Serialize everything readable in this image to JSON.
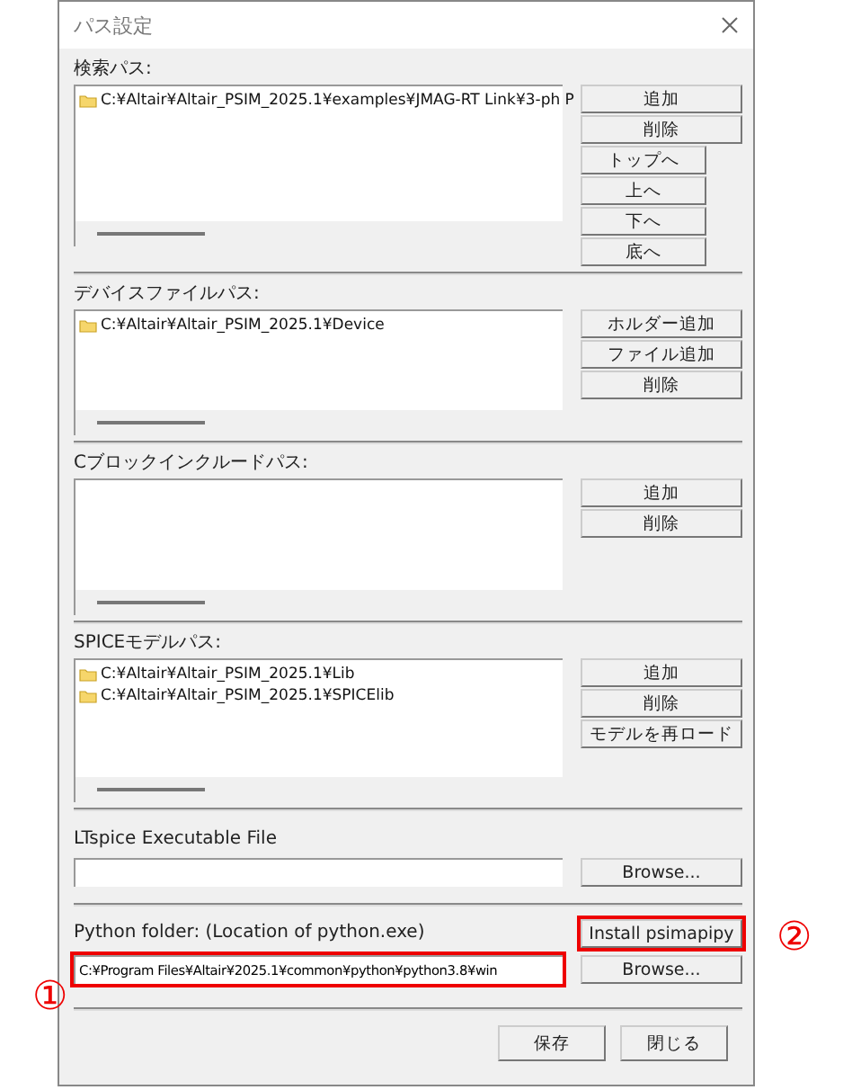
{
  "window": {
    "title": "パス設定"
  },
  "path_sections": [
    {
      "label": "検索パス:",
      "items": [
        "C:¥Altair¥Altair_PSIM_2025.1¥examples¥JMAG-RT Link¥3-ph P"
      ],
      "buttons": [
        {
          "label": "追加",
          "kind": "wide"
        },
        {
          "label": "削除",
          "kind": "wide"
        },
        {
          "label": "トップへ",
          "kind": "narrow"
        },
        {
          "label": "上へ",
          "kind": "narrow"
        },
        {
          "label": "下へ",
          "kind": "narrow"
        },
        {
          "label": "底へ",
          "kind": "narrow"
        }
      ]
    },
    {
      "label": "デバイスファイルパス:",
      "items": [
        "C:¥Altair¥Altair_PSIM_2025.1¥Device"
      ],
      "buttons": [
        {
          "label": "ホルダー追加",
          "kind": "wide"
        },
        {
          "label": "ファイル追加",
          "kind": "wide"
        },
        {
          "label": "削除",
          "kind": "wide"
        }
      ]
    },
    {
      "label": "Cブロックインクルードパス:",
      "buttons": [
        {
          "label": "追加",
          "kind": "wide"
        },
        {
          "label": "削除",
          "kind": "wide"
        }
      ]
    },
    {
      "label": "SPICEモデルパス:",
      "items": [
        "C:¥Altair¥Altair_PSIM_2025.1¥Lib",
        "C:¥Altair¥Altair_PSIM_2025.1¥SPICElib"
      ],
      "buttons": [
        {
          "label": "追加",
          "kind": "wide"
        },
        {
          "label": "削除",
          "kind": "wide"
        },
        {
          "label": "モデルを再ロード",
          "kind": "wide"
        }
      ]
    }
  ],
  "ltspice": {
    "label": "LTspice Executable File",
    "browse": "Browse..."
  },
  "python": {
    "label": "Python folder: (Location of python.exe)",
    "value": "C:¥Program Files¥Altair¥2025.1¥common¥python¥python3.8¥win",
    "value_highlighted": true,
    "install": "Install psimapipy",
    "install_highlighted": true,
    "browse": "Browse..."
  },
  "footer_buttons": [
    "保存",
    "閉じる"
  ],
  "annotations": [
    {
      "text": "①"
    },
    {
      "text": "②"
    }
  ]
}
